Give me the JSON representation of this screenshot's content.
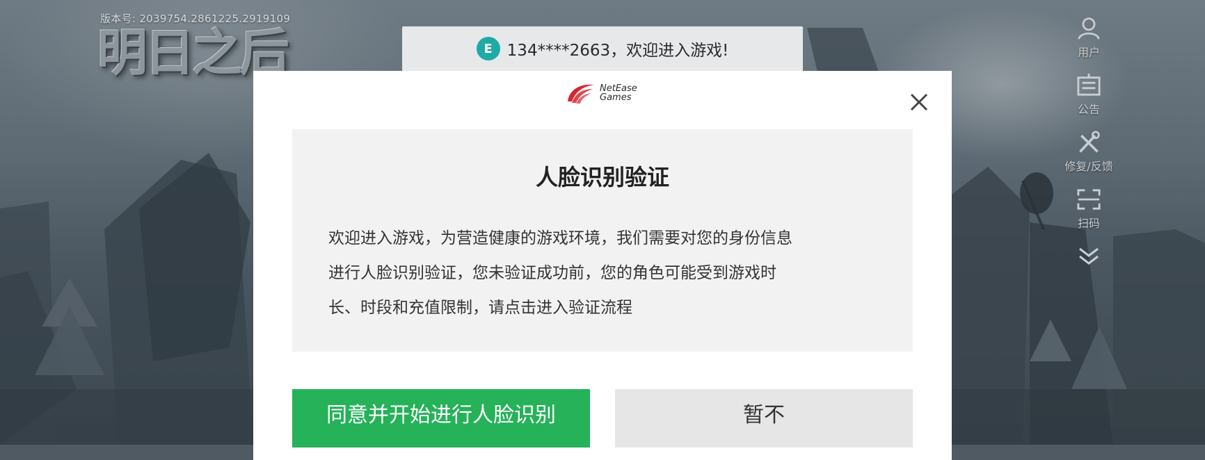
{
  "game": {
    "version": "版本号: 2039754.2861225.2919109",
    "logo_text": "明日之后"
  },
  "toast": {
    "icon_glyph": "E",
    "text": "134****2663，欢迎进入游戏!"
  },
  "side_menu": {
    "items": [
      {
        "label": "用户",
        "icon": "user-icon"
      },
      {
        "label": "公告",
        "icon": "announcement-icon"
      },
      {
        "label": "修复/反馈",
        "icon": "repair-tools-icon"
      },
      {
        "label": "扫码",
        "icon": "scan-icon"
      }
    ],
    "more_icon": "chevron-double-down-icon"
  },
  "dialog": {
    "brand_line1": "NetEase",
    "brand_line2": "Games",
    "title": "人脸识别验证",
    "body_line1": "欢迎进入游戏，为营造健康的游戏环境，我们需要对您的身份信息",
    "body_line2": "进行人脸识别验证，您未验证成功前，您的角色可能受到游戏时",
    "body_line3": "长、时段和充值限制，请点击进入验证流程",
    "agree_label": "同意并开始进行人脸识别",
    "decline_label": "暂不"
  },
  "colors": {
    "accent_green": "#25b259",
    "toast_icon_teal": "#1faaa6",
    "brand_red": "#d8262f"
  }
}
